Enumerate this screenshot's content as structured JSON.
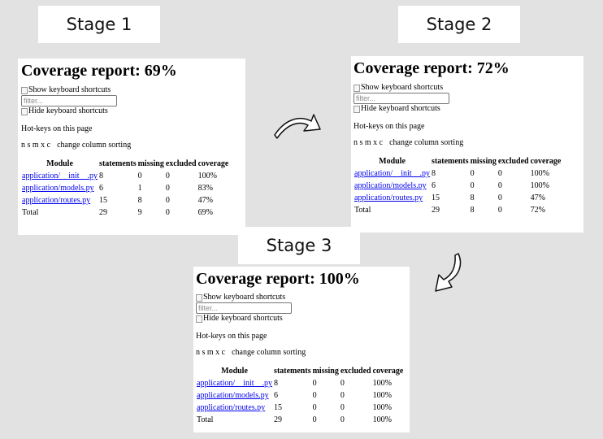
{
  "stages": [
    {
      "label": "Stage 1",
      "title": "Coverage report: 69%",
      "show_shortcuts_alt": "Show keyboard shortcuts",
      "filter_placeholder": "filter...",
      "hide_shortcuts_alt": "Hide keyboard shortcuts",
      "hotkeys_heading": "Hot-keys on this page",
      "hotkeys_keys": "n s m x c",
      "hotkeys_desc": "change column sorting",
      "columns": [
        "Module",
        "statements",
        "missing",
        "excluded",
        "coverage"
      ],
      "rows": [
        {
          "module": "application/__init__.py",
          "statements": "8",
          "missing": "0",
          "excluded": "0",
          "coverage": "100%"
        },
        {
          "module": "application/models.py",
          "statements": "6",
          "missing": "1",
          "excluded": "0",
          "coverage": "83%"
        },
        {
          "module": "application/routes.py",
          "statements": "15",
          "missing": "8",
          "excluded": "0",
          "coverage": "47%"
        }
      ],
      "total": {
        "module": "Total",
        "statements": "29",
        "missing": "9",
        "excluded": "0",
        "coverage": "69%"
      }
    },
    {
      "label": "Stage 2",
      "title": "Coverage report: 72%",
      "show_shortcuts_alt": "Show keyboard shortcuts",
      "filter_placeholder": "filter...",
      "hide_shortcuts_alt": "Hide keyboard shortcuts",
      "hotkeys_heading": "Hot-keys on this page",
      "hotkeys_keys": "n s m x c",
      "hotkeys_desc": "change column sorting",
      "columns": [
        "Module",
        "statements",
        "missing",
        "excluded",
        "coverage"
      ],
      "rows": [
        {
          "module": "application/__init__.py",
          "statements": "8",
          "missing": "0",
          "excluded": "0",
          "coverage": "100%"
        },
        {
          "module": "application/models.py",
          "statements": "6",
          "missing": "0",
          "excluded": "0",
          "coverage": "100%"
        },
        {
          "module": "application/routes.py",
          "statements": "15",
          "missing": "8",
          "excluded": "0",
          "coverage": "47%"
        }
      ],
      "total": {
        "module": "Total",
        "statements": "29",
        "missing": "8",
        "excluded": "0",
        "coverage": "72%"
      }
    },
    {
      "label": "Stage 3",
      "title": "Coverage report: 100%",
      "show_shortcuts_alt": "Show keyboard shortcuts",
      "filter_placeholder": "filter...",
      "hide_shortcuts_alt": "Hide keyboard shortcuts",
      "hotkeys_heading": "Hot-keys on this page",
      "hotkeys_keys": "n s m x c",
      "hotkeys_desc": "change column sorting",
      "columns": [
        "Module",
        "statements",
        "missing",
        "excluded",
        "coverage"
      ],
      "rows": [
        {
          "module": "application/__init__.py",
          "statements": "8",
          "missing": "0",
          "excluded": "0",
          "coverage": "100%"
        },
        {
          "module": "application/models.py",
          "statements": "6",
          "missing": "0",
          "excluded": "0",
          "coverage": "100%"
        },
        {
          "module": "application/routes.py",
          "statements": "15",
          "missing": "0",
          "excluded": "0",
          "coverage": "100%"
        }
      ],
      "total": {
        "module": "Total",
        "statements": "29",
        "missing": "0",
        "excluded": "0",
        "coverage": "100%"
      }
    }
  ],
  "colors": {
    "background": "#e2e2e2",
    "link": "#0000ee",
    "panel": "#ffffff"
  },
  "icons": {
    "arrow_1_to_2": "curved-arrow-right-icon",
    "arrow_2_to_3": "curved-arrow-down-icon"
  }
}
